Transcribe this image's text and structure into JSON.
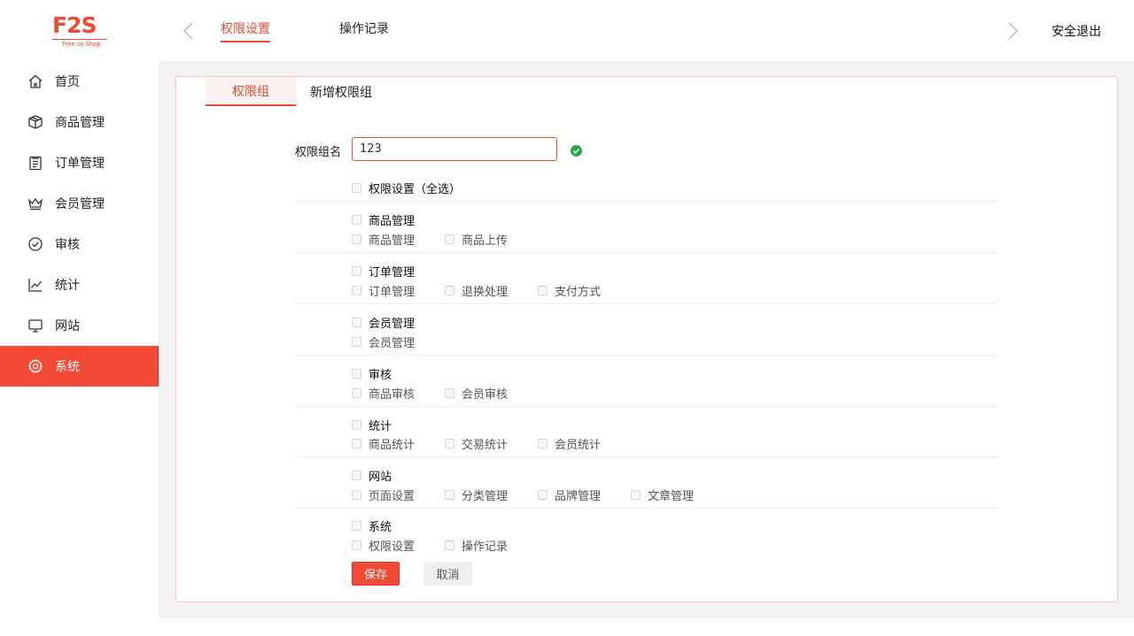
{
  "logo": {
    "mark": "F2S",
    "subtitle": "Free to Shop"
  },
  "sidebar": {
    "items": [
      {
        "label": "首页",
        "icon": "home-icon"
      },
      {
        "label": "商品管理",
        "icon": "box-icon"
      },
      {
        "label": "订单管理",
        "icon": "clipboard-icon"
      },
      {
        "label": "会员管理",
        "icon": "crown-icon"
      },
      {
        "label": "审核",
        "icon": "check-circle-icon"
      },
      {
        "label": "统计",
        "icon": "line-chart-icon"
      },
      {
        "label": "网站",
        "icon": "monitor-icon"
      },
      {
        "label": "系统",
        "icon": "gear-icon",
        "active": true
      }
    ]
  },
  "topbar": {
    "tabs": [
      {
        "label": "权限设置",
        "active": true
      },
      {
        "label": "操作记录",
        "active": false
      }
    ],
    "logout": "安全退出"
  },
  "subtabs": [
    {
      "label": "权限组",
      "active": true
    },
    {
      "label": "新增权限组",
      "active": false
    }
  ],
  "form": {
    "name_label": "权限组名",
    "name_value": "123",
    "select_all": "权限设置（全选）",
    "groups": [
      {
        "title": "商品管理",
        "children": [
          "商品管理",
          "商品上传"
        ]
      },
      {
        "title": "订单管理",
        "children": [
          "订单管理",
          "退换处理",
          "支付方式"
        ]
      },
      {
        "title": "会员管理",
        "children": [
          "会员管理"
        ]
      },
      {
        "title": "审核",
        "children": [
          "商品审核",
          "会员审核"
        ]
      },
      {
        "title": "统计",
        "children": [
          "商品统计",
          "交易统计",
          "会员统计"
        ]
      },
      {
        "title": "网站",
        "children": [
          "页面设置",
          "分类管理",
          "品牌管理",
          "文章管理"
        ]
      },
      {
        "title": "系统",
        "children": [
          "权限设置",
          "操作记录"
        ]
      }
    ],
    "save_label": "保存",
    "cancel_label": "取消"
  },
  "colors": {
    "accent": "#f24a35",
    "valid": "#2aa84a"
  }
}
